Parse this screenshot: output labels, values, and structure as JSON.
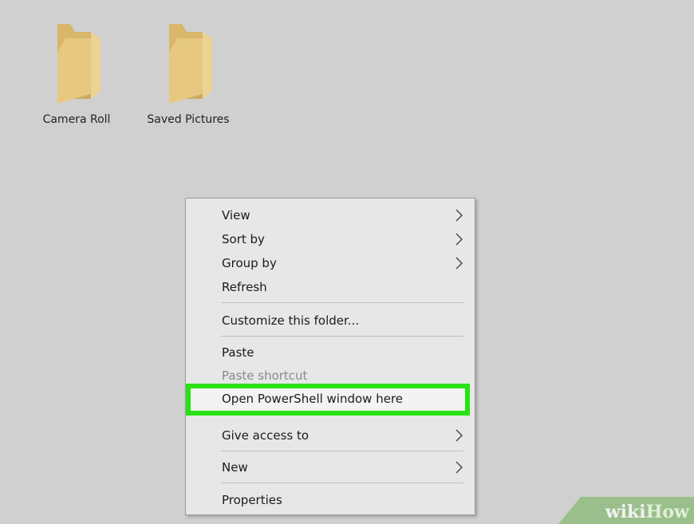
{
  "folders": [
    {
      "label": "Camera Roll"
    },
    {
      "label": "Saved Pictures"
    }
  ],
  "context_menu": {
    "items": {
      "view": "View",
      "sort_by": "Sort by",
      "group_by": "Group by",
      "refresh": "Refresh",
      "customize": "Customize this folder...",
      "paste": "Paste",
      "paste_shortcut": "Paste shortcut",
      "open_powershell": "Open PowerShell window here",
      "give_access": "Give access to",
      "new": "New",
      "properties": "Properties"
    },
    "highlight_color": "#27e214"
  },
  "watermark": {
    "wiki": "wiki",
    "how": "How"
  },
  "icons": {
    "folder": "folder-icon",
    "submenu": "chevron-right-icon"
  },
  "colors": {
    "background": "#d0d0d0",
    "folder": "#e2c27a",
    "menu": "#e7e7e7"
  }
}
